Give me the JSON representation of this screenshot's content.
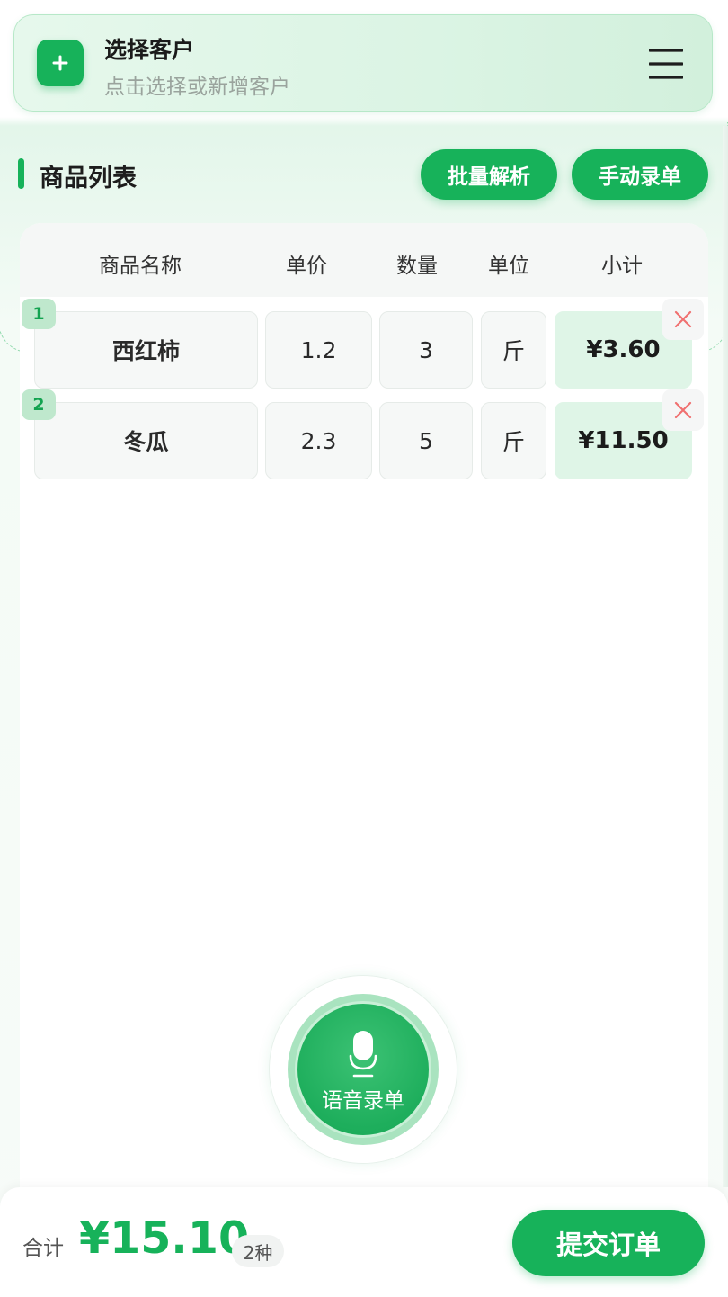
{
  "customer": {
    "title": "选择客户",
    "subtitle": "点击选择或新增客户"
  },
  "section": {
    "title": "商品列表",
    "batch_parse_label": "批量解析",
    "manual_entry_label": "手动录单"
  },
  "table": {
    "headers": {
      "name": "商品名称",
      "price": "单价",
      "qty": "数量",
      "unit": "单位",
      "subtotal": "小计"
    },
    "rows": [
      {
        "index": "1",
        "name": "西红柿",
        "price": "1.2",
        "qty": "3",
        "unit": "斤",
        "subtotal": "¥3.60"
      },
      {
        "index": "2",
        "name": "冬瓜",
        "price": "2.3",
        "qty": "5",
        "unit": "斤",
        "subtotal": "¥11.50"
      }
    ]
  },
  "voice": {
    "label": "语音录单"
  },
  "footer": {
    "total_label": "合计",
    "total_amount": "¥15.10",
    "kinds": "2种",
    "submit_label": "提交订单"
  },
  "colors": {
    "accent": "#17b25a",
    "delete": "#f07070"
  },
  "icons": {
    "add": "plus-icon",
    "menu": "hamburger-menu-icon",
    "delete": "close-icon",
    "voice": "microphone-icon"
  }
}
